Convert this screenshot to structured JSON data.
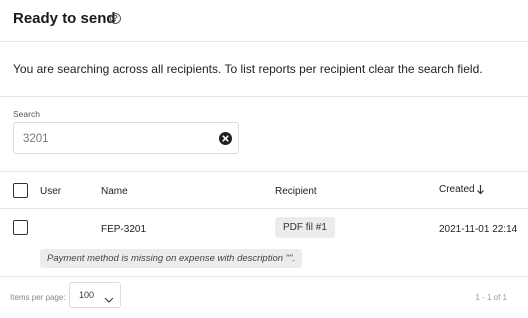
{
  "header": {
    "title": "Ready to send",
    "help_icon": "help-circle-icon"
  },
  "notice": {
    "text": "You are searching across all recipients. To list reports per recipient clear the search field."
  },
  "search": {
    "label": "Search",
    "value": "3201",
    "clear_icon": "clear-circle-icon"
  },
  "table": {
    "columns": {
      "user": "User",
      "name": "Name",
      "recipient": "Recipient",
      "created": "Created"
    },
    "sort": {
      "column": "created",
      "direction": "desc",
      "icon": "arrow-down-icon"
    },
    "rows": [
      {
        "name": "FEP-3201",
        "recipient": "PDF fil #1",
        "created": "2021-11-01 22:14",
        "warning": "Payment method is missing on expense with description \"\"."
      }
    ]
  },
  "footer": {
    "items_per_page_label": "Items per page:",
    "items_per_page_value": "100",
    "pagination": "1 - 1 of 1"
  }
}
